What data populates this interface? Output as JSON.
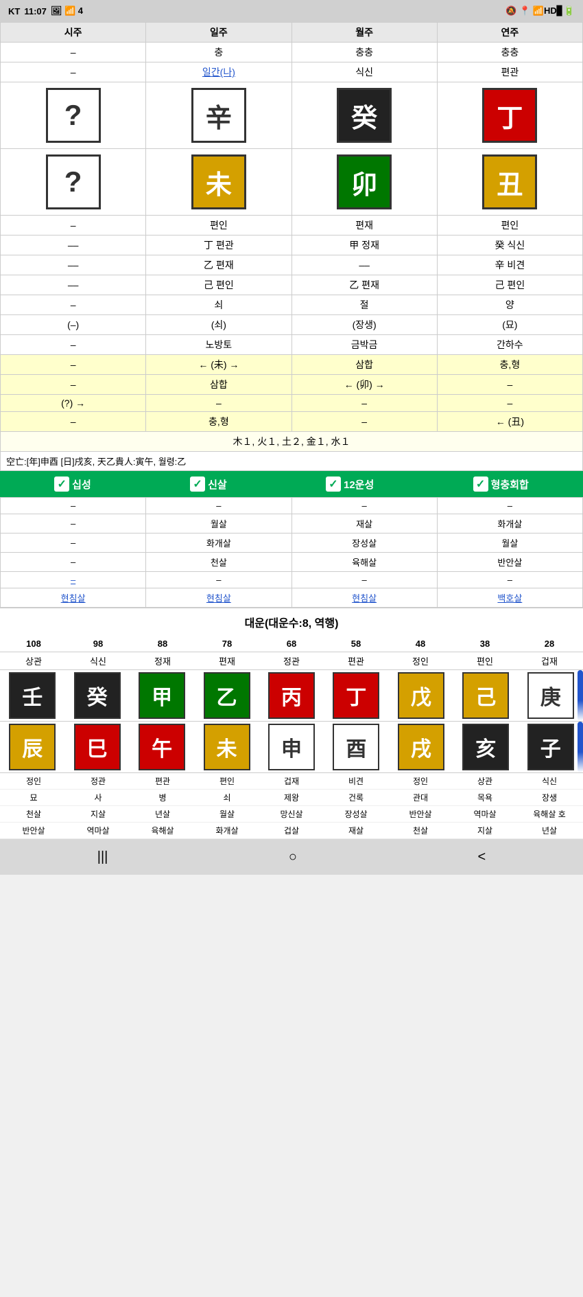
{
  "statusBar": {
    "carrier": "KT",
    "time": "11:07",
    "rightIcons": "🔕 📍 📶 HD ▊ 🔋"
  },
  "header": {
    "cols": [
      "시주",
      "일주",
      "월주",
      "연주"
    ]
  },
  "row1": {
    "cells": [
      "–",
      "충",
      "충충",
      "충충"
    ]
  },
  "row2": {
    "cells": [
      "–",
      "일간(나)",
      "식신",
      "편관"
    ],
    "linkCol": 1
  },
  "tianGan": {
    "cells": [
      {
        "char": "?",
        "style": "question"
      },
      {
        "char": "辛",
        "style": "white"
      },
      {
        "char": "癸",
        "style": "black"
      },
      {
        "char": "丁",
        "style": "red"
      }
    ]
  },
  "diZhi": {
    "cells": [
      {
        "char": "?",
        "style": "question"
      },
      {
        "char": "未",
        "style": "gold"
      },
      {
        "char": "卯",
        "style": "green"
      },
      {
        "char": "丑",
        "style": "gold"
      }
    ]
  },
  "row3": {
    "cells": [
      "–",
      "편인",
      "편재",
      "편인"
    ]
  },
  "row4a": {
    "cells": [
      "––",
      "丁 편관",
      "甲 정재",
      "癸 식신"
    ]
  },
  "row4b": {
    "cells": [
      "––",
      "乙 편재",
      "––",
      "辛 비견"
    ]
  },
  "row4c": {
    "cells": [
      "––",
      "己 편인",
      "乙 편재",
      "己 편인"
    ]
  },
  "row5a": {
    "cells": [
      "–",
      "쇠",
      "절",
      "양"
    ]
  },
  "row5b": {
    "cells": [
      "(–)",
      "(쇠)",
      "(장생)",
      "(묘)"
    ]
  },
  "row6": {
    "cells": [
      "–",
      "노방토",
      "금박금",
      "간하수"
    ]
  },
  "row7a": {
    "cells": [
      "–",
      "← (未) →",
      "삼합",
      "충,형"
    ],
    "highlight": true
  },
  "row7b": {
    "cells": [
      "–",
      "삼합",
      "← (卯) →",
      "–"
    ],
    "highlight": true
  },
  "row7c": {
    "cells": [
      "(?) →",
      "–",
      "–",
      "–"
    ],
    "highlight": true
  },
  "row7d": {
    "cells": [
      "–",
      "충,형",
      "–",
      "← (丑)"
    ],
    "highlight": true
  },
  "elementRow": {
    "text": "木１, 火１, 土２, 金１, 水１"
  },
  "gongmangRow": {
    "text": "空亡:[年]申酉 [日]戌亥, 天乙貴人:寅午, 월령:乙"
  },
  "checkboxes": {
    "items": [
      "십성",
      "신살",
      "12운성",
      "형충회합"
    ]
  },
  "salTable": {
    "headers": [
      "시주",
      "일주",
      "월주",
      "연주"
    ],
    "rows": [
      [
        "–",
        "–",
        "–",
        "–"
      ],
      [
        "–",
        "월살",
        "재살",
        "화개살"
      ],
      [
        "–",
        "화개살",
        "장성살",
        "월살"
      ],
      [
        "–",
        "천살",
        "육해살",
        "반안살"
      ],
      [
        "–",
        "–",
        "–",
        "–"
      ],
      [
        "현침살",
        "현침살",
        "현침살",
        "백호살"
      ]
    ],
    "linkRows": [
      5
    ]
  },
  "daeun": {
    "headerText": "대운(대운수:8, 역행)",
    "numbers": [
      "108",
      "98",
      "88",
      "78",
      "68",
      "58",
      "48",
      "38",
      "28"
    ],
    "types": [
      "상관",
      "식신",
      "정재",
      "편재",
      "정관",
      "편관",
      "정인",
      "편인",
      "겁재"
    ],
    "tianGan": [
      {
        "char": "壬",
        "style": "black"
      },
      {
        "char": "癸",
        "style": "black"
      },
      {
        "char": "甲",
        "style": "green"
      },
      {
        "char": "乙",
        "style": "green"
      },
      {
        "char": "丙",
        "style": "red"
      },
      {
        "char": "丁",
        "style": "red"
      },
      {
        "char": "戊",
        "style": "gold"
      },
      {
        "char": "己",
        "style": "gold"
      },
      {
        "char": "庚",
        "style": "white"
      }
    ],
    "diZhi": [
      {
        "char": "辰",
        "style": "gold"
      },
      {
        "char": "巳",
        "style": "red"
      },
      {
        "char": "午",
        "style": "red"
      },
      {
        "char": "未",
        "style": "gold"
      },
      {
        "char": "申",
        "style": "white"
      },
      {
        "char": "酉",
        "style": "white"
      },
      {
        "char": "戌",
        "style": "gold"
      },
      {
        "char": "亥",
        "style": "black"
      },
      {
        "char": "子",
        "style": "black"
      }
    ],
    "bottomRows": [
      [
        "정인",
        "정관",
        "편관",
        "편인",
        "겁재",
        "비견",
        "정인",
        "상관",
        "식신"
      ],
      [
        "묘",
        "사",
        "병",
        "쇠",
        "제왕",
        "건록",
        "관대",
        "목욕",
        "장생"
      ],
      [
        "천살",
        "지살",
        "년살",
        "월살",
        "망신살",
        "장성살",
        "반안살",
        "역마살",
        "육해살 호"
      ],
      [
        "반안살",
        "역마살",
        "육해살",
        "화개살",
        "겁살",
        "재살",
        "천살",
        "지살",
        "년살"
      ]
    ]
  },
  "bottomNav": {
    "back": "|||",
    "home": "○",
    "recent": "<"
  }
}
